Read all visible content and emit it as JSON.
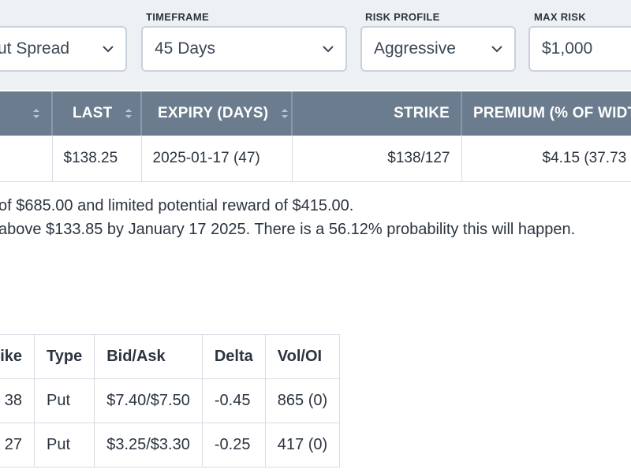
{
  "filters": {
    "strategy": {
      "value": "ut Spread"
    },
    "timeframe": {
      "label": "TIMEFRAME",
      "value": "45 Days"
    },
    "risk_profile": {
      "label": "RISK PROFILE",
      "value": "Aggressive"
    },
    "max_risk": {
      "label": "MAX RISK",
      "value": "$1,000"
    }
  },
  "results": {
    "columns": [
      "",
      "LAST",
      "EXPIRY (DAYS)",
      "STRIKE",
      "PREMIUM (% OF WIDTH"
    ],
    "row": [
      "",
      "$138.25",
      "2025-01-17 (47)",
      "$138/127",
      "$4.15 (37.73"
    ]
  },
  "summary": {
    "line1": "of $685.00 and limited potential reward of $415.00.",
    "line2": "above $133.85 by January 17 2025. There is a 56.12% probability this will happen."
  },
  "legs": {
    "columns": [
      "ike",
      "Type",
      "Bid/Ask",
      "Delta",
      "Vol/OI"
    ],
    "rows": [
      [
        "38",
        "Put",
        "$7.40/$7.50",
        "-0.45",
        "865 (0)"
      ],
      [
        "27",
        "Put",
        "$3.25/$3.30",
        "-0.25",
        "417 (0)"
      ]
    ]
  }
}
